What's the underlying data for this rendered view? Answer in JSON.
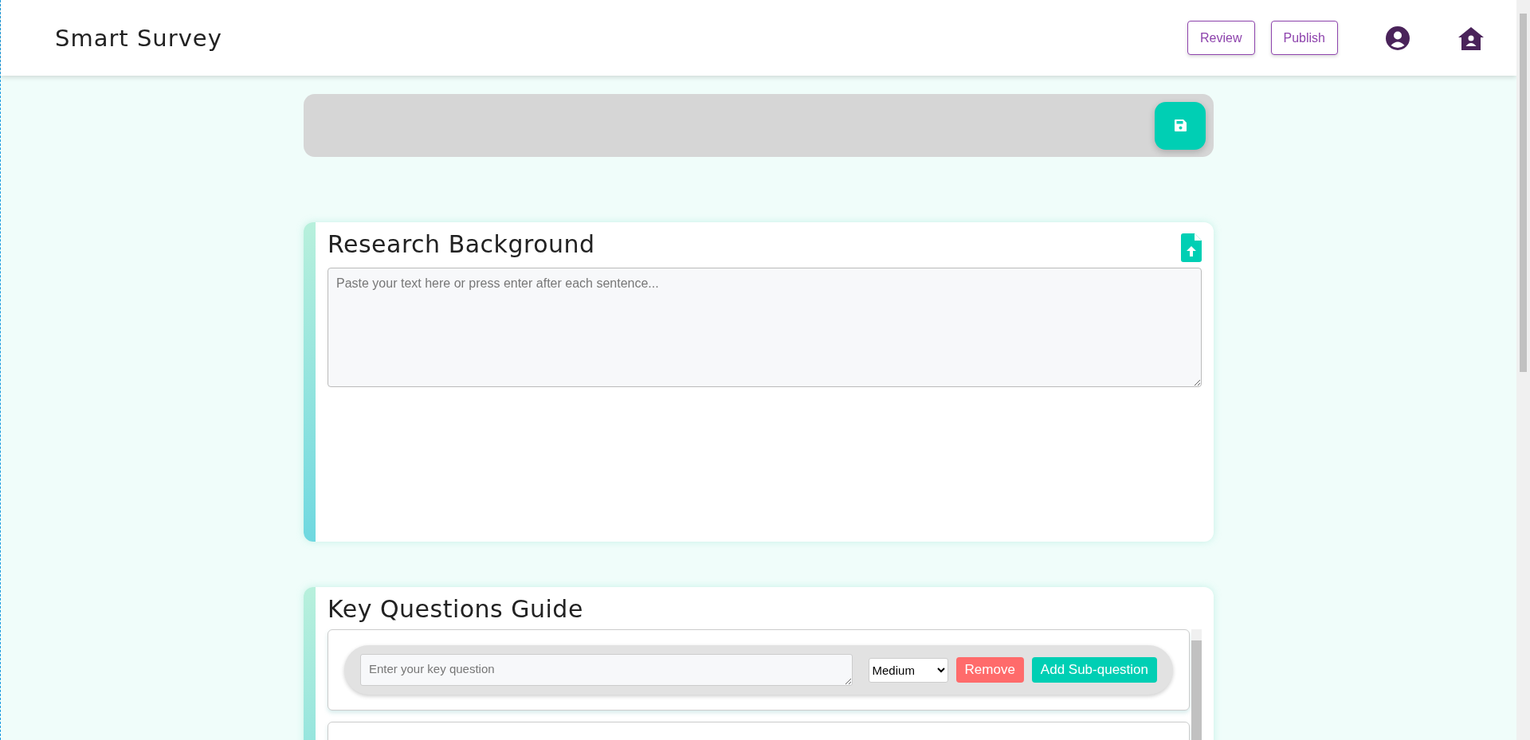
{
  "header": {
    "title": "Smart Survey",
    "buttons": [
      {
        "label": "Review"
      },
      {
        "label": "Publish"
      }
    ]
  },
  "sections": [
    {
      "kind": "background",
      "title": "Research Background",
      "placeholder": "Paste your text here or press enter after each sentence..."
    },
    {
      "kind": "questions",
      "title": "Key Questions Guide",
      "questions": [
        {
          "placeholder": "Enter your key question",
          "priority": "Medium",
          "actions": [
            {
              "label": "Remove",
              "kind": "danger"
            },
            {
              "label": "Add Sub-question",
              "kind": "primary"
            }
          ]
        }
      ]
    }
  ]
}
